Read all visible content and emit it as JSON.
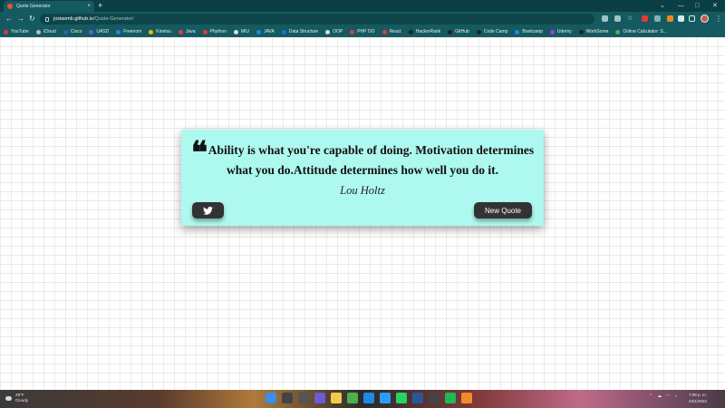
{
  "browser": {
    "tab_title": "Quote Generator",
    "tab_close": "×",
    "new_tab": "+",
    "url_host": "josiasmb.github.io",
    "url_path": "/Quote-Generator/",
    "window_controls": [
      "⌄",
      "—",
      "□",
      "✕"
    ],
    "bookmarks": [
      {
        "label": "YouTube",
        "color": "#e53935"
      },
      {
        "label": "iCloud",
        "color": "#bbbbbb"
      },
      {
        "label": "Cisco",
        "color": "#1b6aa5"
      },
      {
        "label": "UASD",
        "color": "#6b5bd6"
      },
      {
        "label": "Freenom",
        "color": "#1e88e5"
      },
      {
        "label": "Kinetsu",
        "color": "#f4b400"
      },
      {
        "label": "Java",
        "color": "#e53935"
      },
      {
        "label": "Phython",
        "color": "#e53935"
      },
      {
        "label": "MIU",
        "color": "#dddddd"
      },
      {
        "label": "JAVA",
        "color": "#1e88e5"
      },
      {
        "label": "Data Structure",
        "color": "#1976d2"
      },
      {
        "label": "OOP",
        "color": "#dddddd"
      },
      {
        "label": "PHP OO",
        "color": "#e53935"
      },
      {
        "label": "React",
        "color": "#e53935"
      },
      {
        "label": "HackerRank",
        "color": "#222222"
      },
      {
        "label": "GitHub",
        "color": "#222222"
      },
      {
        "label": "Code Camp",
        "color": "#222222"
      },
      {
        "label": "Bootcamp",
        "color": "#1e88e5"
      },
      {
        "label": "Udemy",
        "color": "#a435f0"
      },
      {
        "label": "WorkSome",
        "color": "#222222"
      },
      {
        "label": "Online Calculator: S...",
        "color": "#4caf50"
      }
    ]
  },
  "quote": {
    "text": "Ability is what you're capable of doing. Motivation determines what you do.Attitude determines how well you do it.",
    "author": "Lou Holtz",
    "new_quote_label": "New Quote",
    "twitter_icon": "twitter-icon"
  },
  "taskbar": {
    "weather_temp": "29°F",
    "weather_desc": "Cloudy",
    "time": "7:09 p. m.",
    "date": "24/1/2022"
  }
}
